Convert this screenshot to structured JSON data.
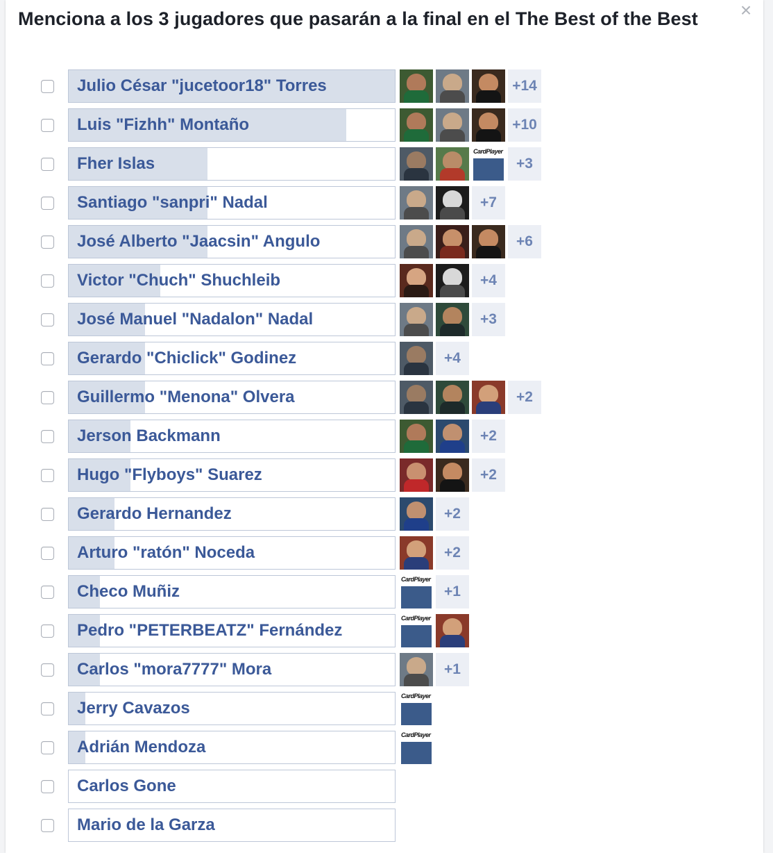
{
  "dialog": {
    "title": "Menciona a los 3 jugadores que pasarán a la final en el The Best of the Best",
    "close_glyph": "×"
  },
  "colors": {
    "label": "#3b5998",
    "bar_fill": "#d8dfea",
    "bar_border": "#bdc7d8",
    "more_bg": "#eceff5",
    "more_text": "#6d84b4"
  },
  "options": [
    {
      "label": "Julio César \"jucetoor18\" Torres",
      "share": 1.0,
      "voters": [
        "green-man",
        "two-players",
        "sunglasses-man"
      ],
      "more": "+14"
    },
    {
      "label": "Luis \"Fizhh\" Montaño",
      "share": 0.85,
      "voters": [
        "green-man",
        "two-players",
        "sunglasses-man"
      ],
      "more": "+10"
    },
    {
      "label": "Fher Islas",
      "share": 0.425,
      "voters": [
        "poker-table",
        "red-cap-man",
        "cardplayer-logo"
      ],
      "more": "+3"
    },
    {
      "label": "Santiago \"sanpri\" Nadal",
      "share": 0.425,
      "voters": [
        "two-players",
        "bw-couple"
      ],
      "more": "+7"
    },
    {
      "label": "José Alberto \"Jaacsin\" Angulo",
      "share": 0.425,
      "voters": [
        "two-players",
        "player-chips",
        "sunglasses-man"
      ],
      "more": "+6"
    },
    {
      "label": "Victor \"Chuch\" Shuchleib",
      "share": 0.28,
      "voters": [
        "woman-portrait",
        "bw-couple"
      ],
      "more": "+4"
    },
    {
      "label": "José Manuel \"Nadalon\" Nadal",
      "share": 0.235,
      "voters": [
        "two-players",
        "man-at-table"
      ],
      "more": "+3"
    },
    {
      "label": "Gerardo \"Chiclick\" Godinez",
      "share": 0.235,
      "voters": [
        "poker-table"
      ],
      "more": "+4"
    },
    {
      "label": "Guillermo \"Menona\" Olvera",
      "share": 0.235,
      "voters": [
        "poker-table",
        "man-at-table",
        "man-with-dog"
      ],
      "more": "+2"
    },
    {
      "label": "Jerson Backmann",
      "share": 0.19,
      "voters": [
        "green-man",
        "blue-cap-player"
      ],
      "more": "+2"
    },
    {
      "label": "Hugo \"Flyboys\" Suarez",
      "share": 0.19,
      "voters": [
        "red-shirt-man",
        "sunglasses-man"
      ],
      "more": "+2"
    },
    {
      "label": "Gerardo Hernandez",
      "share": 0.14,
      "voters": [
        "blue-cap-player"
      ],
      "more": "+2"
    },
    {
      "label": "Arturo \"ratón\" Noceda",
      "share": 0.14,
      "voters": [
        "man-with-dog"
      ],
      "more": "+2"
    },
    {
      "label": "Checo Muñiz",
      "share": 0.095,
      "voters": [
        "cardplayer-logo"
      ],
      "more": "+1"
    },
    {
      "label": "Pedro \"PETERBEATZ\" Fernández",
      "share": 0.095,
      "voters": [
        "cardplayer-logo",
        "man-with-dog"
      ],
      "more": ""
    },
    {
      "label": "Carlos \"mora7777\" Mora",
      "share": 0.095,
      "voters": [
        "two-players"
      ],
      "more": "+1"
    },
    {
      "label": "Jerry Cavazos",
      "share": 0.05,
      "voters": [
        "cardplayer-logo"
      ],
      "more": ""
    },
    {
      "label": "Adrián Mendoza",
      "share": 0.05,
      "voters": [
        "cardplayer-logo"
      ],
      "more": ""
    },
    {
      "label": "Carlos Gone",
      "share": 0.0,
      "voters": [],
      "more": ""
    },
    {
      "label": "Mario de la Garza",
      "share": 0.0,
      "voters": [],
      "more": ""
    }
  ],
  "thumb_text": {
    "cardplayer-logo": "CardPlayer"
  }
}
